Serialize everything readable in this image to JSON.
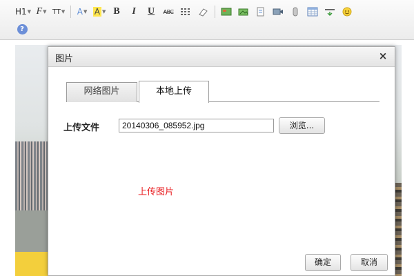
{
  "toolbar": {
    "heading_label": "H1",
    "font_family_label": "F",
    "font_size_label": "TT",
    "font_color_label": "A",
    "highlight_label": "A",
    "bold_label": "B",
    "italic_label": "I",
    "underline_label": "U",
    "strikethrough_label": "ABC",
    "help_label": "?"
  },
  "dialog": {
    "title": "图片",
    "close_label": "×",
    "tabs": [
      {
        "label": "网络图片"
      },
      {
        "label": "本地上传"
      }
    ],
    "upload_label": "上传文件",
    "file_value": "20140306_085952.jpg",
    "browse_label": "浏览...",
    "upload_area_label": "上传图片",
    "ok_label": "确定",
    "cancel_label": "取消"
  },
  "colors": {
    "highlight": "#ffe64d",
    "font_color": "#5b8bd6",
    "upload_text": "#e8191c"
  }
}
